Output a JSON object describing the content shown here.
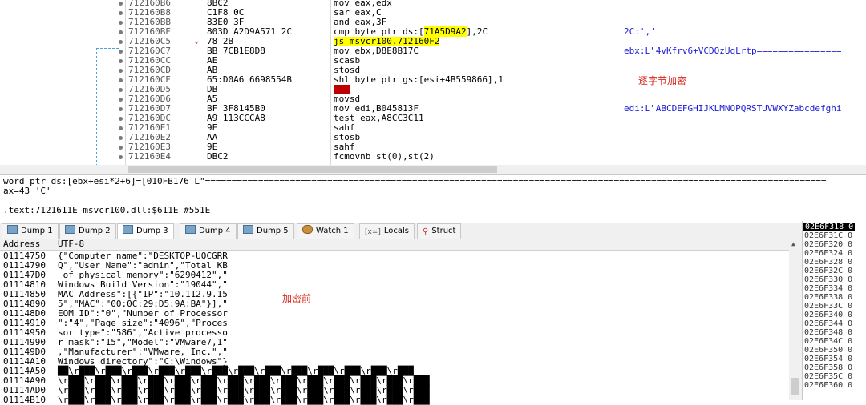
{
  "disasm": {
    "rows": [
      {
        "addr": "712160B6",
        "bytes": "8BC2",
        "instr": "mov eax,edx",
        "comment": ""
      },
      {
        "addr": "712160B8",
        "bytes": "C1F8 0C",
        "instr": "sar eax,C",
        "comment": ""
      },
      {
        "addr": "712160BB",
        "bytes": "83E0 3F",
        "instr": "and eax,3F",
        "comment": ""
      },
      {
        "addr": "712160BE",
        "bytes": "803D A2D9A571 2C",
        "instr": "cmp byte ptr ds:[71A5D9A2],2C",
        "comment": "2C:','"
      },
      {
        "addr": "712160C5",
        "bytes": "78 2B",
        "instr": "js msvcr100.712160F2",
        "comment": ""
      },
      {
        "addr": "712160C7",
        "bytes": "BB 7CB1E8D8",
        "instr": "mov ebx,D8E8B17C",
        "comment": "ebx:L\"4vKfrv6+VCDOzUqLrtp================"
      },
      {
        "addr": "712160CC",
        "bytes": "AE",
        "instr": "scasb",
        "comment": ""
      },
      {
        "addr": "712160CD",
        "bytes": "AB",
        "instr": "stosd",
        "comment": ""
      },
      {
        "addr": "712160CE",
        "bytes": "65:D0A6 6698554B",
        "instr": "shl byte ptr gs:[esi+4B559866],1",
        "comment": ""
      },
      {
        "addr": "712160D5",
        "bytes": "DB",
        "instr": "???",
        "comment": ""
      },
      {
        "addr": "712160D6",
        "bytes": "A5",
        "instr": "movsd",
        "comment": ""
      },
      {
        "addr": "712160D7",
        "bytes": "BF 3F8145B0",
        "instr": "mov edi,B045813F",
        "comment": "edi:L\"ABCDEFGHIJKLMNOPQRSTUVWXYZabcdefghi"
      },
      {
        "addr": "712160DC",
        "bytes": "A9 113CCCA8",
        "instr": "test eax,A8CC3C11",
        "comment": ""
      },
      {
        "addr": "712160E1",
        "bytes": "9E",
        "instr": "sahf",
        "comment": ""
      },
      {
        "addr": "712160E2",
        "bytes": "AA",
        "instr": "stosb",
        "comment": ""
      },
      {
        "addr": "712160E3",
        "bytes": "9E",
        "instr": "sahf",
        "comment": ""
      },
      {
        "addr": "712160E4",
        "bytes": "DBC2",
        "instr": "fcmovnb st(0),st(2)",
        "comment": ""
      }
    ],
    "note": "逐字节加密"
  },
  "info": {
    "line1": "word ptr ds:[ebx+esi*2+6]=[010FB176 L\"=====================================================================================================================",
    "line2": "ax=43 'C'",
    "line3": ".text:7121611E msvcr100.dll:$611E #551E"
  },
  "tabs": [
    {
      "label": "Dump 1",
      "icon": "memory-icon"
    },
    {
      "label": "Dump 2",
      "icon": "memory-icon"
    },
    {
      "label": "Dump 3",
      "icon": "memory-icon",
      "active": true
    },
    {
      "label": "Dump 4",
      "icon": "memory-icon"
    },
    {
      "label": "Dump 5",
      "icon": "memory-icon"
    },
    {
      "label": "Watch 1",
      "icon": "watch-icon"
    },
    {
      "label": "Locals",
      "icon": "locals-icon"
    },
    {
      "label": "Struct",
      "icon": "struct-icon"
    }
  ],
  "dump": {
    "header_address": "Address",
    "header_text": "UTF-8",
    "note": "加密前",
    "rows": [
      {
        "addr": "01114750",
        "text": "{\"Computer name\":\"DESKTOP-UQCGRR"
      },
      {
        "addr": "01114790",
        "text": "Q\",\"User Name\":\"admin\",\"Total KB"
      },
      {
        "addr": "011147D0",
        "text": " of physical memory\":\"6290412\",\""
      },
      {
        "addr": "01114810",
        "text": "Windows Build Version\":\"19044\",\""
      },
      {
        "addr": "01114850",
        "text": "MAC Address\":[{\"IP\":\"10.112.9.15"
      },
      {
        "addr": "01114890",
        "text": "5\",\"MAC\":\"00:0C:29:D5:9A:BA\"}],\""
      },
      {
        "addr": "011148D0",
        "text": "EOM ID\":\"0\",\"Number of Processor"
      },
      {
        "addr": "01114910",
        "text": "\":\"4\",\"Page size\":\"4096\",\"Proces"
      },
      {
        "addr": "01114950",
        "text": "sor type\":\"586\",\"Active processo"
      },
      {
        "addr": "01114990",
        "text": "r mask\":\"15\",\"Model\":\"VMware7,1\""
      },
      {
        "addr": "011149D0",
        "text": ",\"Manufacturer\":\"VMware, Inc.\",\""
      },
      {
        "addr": "01114A10",
        "text": "Windows directory\":\"C:\\Windows\"}"
      },
      {
        "addr": "01114A50",
        "text": "██\\r███\\r███\\r███\\r███\\r███\\r███\\r███\\r███\\r███\\r███\\r███\\r███\\r███"
      },
      {
        "addr": "01114A90",
        "text": "\\r███\\r███\\r███\\r███\\r███\\r███\\r███\\r███\\r███\\r███\\r███\\r███\\r███\\r███"
      },
      {
        "addr": "01114AD0",
        "text": "\\r███\\r███\\r███\\r███\\r███\\r███\\r███\\r███\\r███\\r███\\r███\\r███\\r███\\r███"
      },
      {
        "addr": "01114B10",
        "text": "\\r███\\r███\\r███\\r███\\r███\\r███\\r███\\r███\\r███\\r███\\r███\\r███\\r███\\r███"
      }
    ]
  },
  "stack": {
    "rows": [
      "02E6F318",
      "02E6F31C",
      "02E6F320",
      "02E6F324",
      "02E6F328",
      "02E6F32C",
      "02E6F330",
      "02E6F334",
      "02E6F338",
      "02E6F33C",
      "02E6F340",
      "02E6F344",
      "02E6F348",
      "02E6F34C",
      "02E6F350",
      "02E6F354",
      "02E6F358",
      "02E6F35C",
      "02E6F360"
    ],
    "value_prefix": "0"
  }
}
